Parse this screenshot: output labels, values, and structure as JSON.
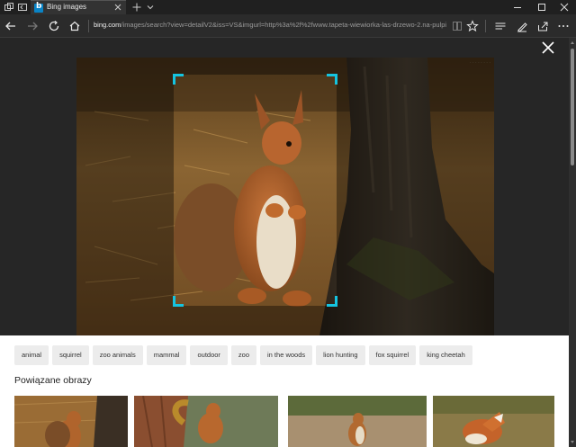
{
  "browser": {
    "tab_title": "Bing images",
    "url_host": "bing.com",
    "url_path": "/images/search?view=detailV2&iss=VS&imgurl=http%3a%2f%2fwww.tapeta-wiewiorka-las-drzewo-2.na-pulpit.com"
  },
  "related_tags": [
    "animal",
    "squirrel",
    "zoo animals",
    "mammal",
    "outdoor",
    "zoo",
    "in the woods",
    "lion hunting",
    "fox squirrel",
    "king cheetah"
  ],
  "related_section": {
    "title": "Powiązane obrazy"
  },
  "colors": {
    "crop_accent": "#15c4e0",
    "chrome_dark": "#202020",
    "tag_bg": "#ececec"
  },
  "icons": [
    "tab-actions-icon",
    "back-tabs-icon",
    "bing-favicon",
    "close-tab-icon",
    "new-tab-icon",
    "tab-list-icon",
    "minimize-icon",
    "maximize-icon",
    "window-close-icon",
    "back-icon",
    "forward-icon",
    "refresh-icon",
    "home-icon",
    "reading-view-icon",
    "favorite-star-icon",
    "hub-icon",
    "notes-icon",
    "share-icon",
    "more-icon",
    "close-viewer-icon"
  ]
}
